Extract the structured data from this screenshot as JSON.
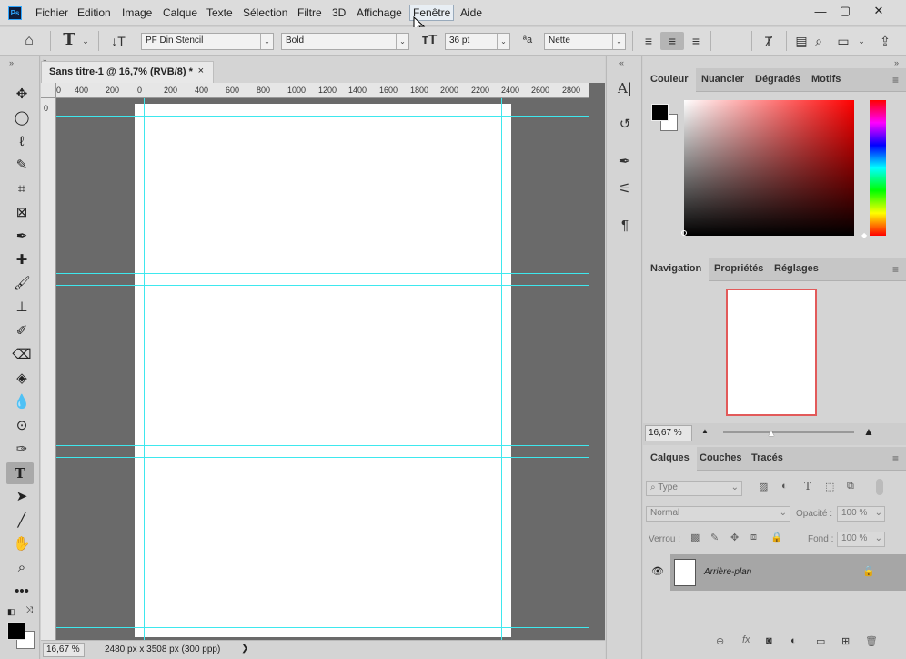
{
  "app": {
    "logo": "Ps"
  },
  "menu": [
    "Fichier",
    "Edition",
    "Image",
    "Calque",
    "Texte",
    "Sélection",
    "Filtre",
    "3D",
    "Affichage",
    "Fenêtre",
    "Aide"
  ],
  "window_controls": {
    "minimize": "—",
    "maximize": "▢",
    "close": "✕"
  },
  "options": {
    "font_family": "PF Din Stencil",
    "font_style": "Bold",
    "font_size": "36 pt",
    "antialias_label": "ªa",
    "antialias": "Nette"
  },
  "document": {
    "tab_title": "Sans titre-1 @ 16,7% (RVB/8) *",
    "close": "×"
  },
  "ruler": {
    "h_labels": [
      "0",
      "400",
      "200",
      "0",
      "200",
      "400",
      "600",
      "800",
      "1000",
      "1200",
      "1400",
      "1600",
      "1800",
      "2000",
      "2200",
      "2400",
      "2600",
      "2800"
    ],
    "v_labels": [
      "0"
    ]
  },
  "status": {
    "zoom": "16,67 %",
    "doc_size": "2480 px x 3508 px (300 ppp)",
    "arrow": "❯"
  },
  "color_panel": {
    "tabs": [
      "Couleur",
      "Nuancier",
      "Dégradés",
      "Motifs"
    ],
    "active_hue": "#ff0000",
    "foreground": "#000000",
    "background": "#ffffff"
  },
  "nav_panel": {
    "tabs": [
      "Navigation",
      "Propriétés",
      "Réglages"
    ],
    "zoom": "16,67 %",
    "preview_border": "#e25a5a"
  },
  "layers_panel": {
    "tabs": [
      "Calques",
      "Couches",
      "Tracés"
    ],
    "filter_placeholder": "Type",
    "blend_mode": "Normal",
    "opacity_label": "Opacité :",
    "opacity": "100 %",
    "lock_label": "Verrou :",
    "fill_label": "Fond :",
    "fill": "100 %",
    "layers": [
      {
        "name": "Arrière-plan",
        "locked": true,
        "visible": true
      }
    ]
  },
  "colors": {
    "guide": "#3ee8ee",
    "canvas_bg": "#6a6a6a",
    "ui_bg": "#d4d4d4"
  }
}
